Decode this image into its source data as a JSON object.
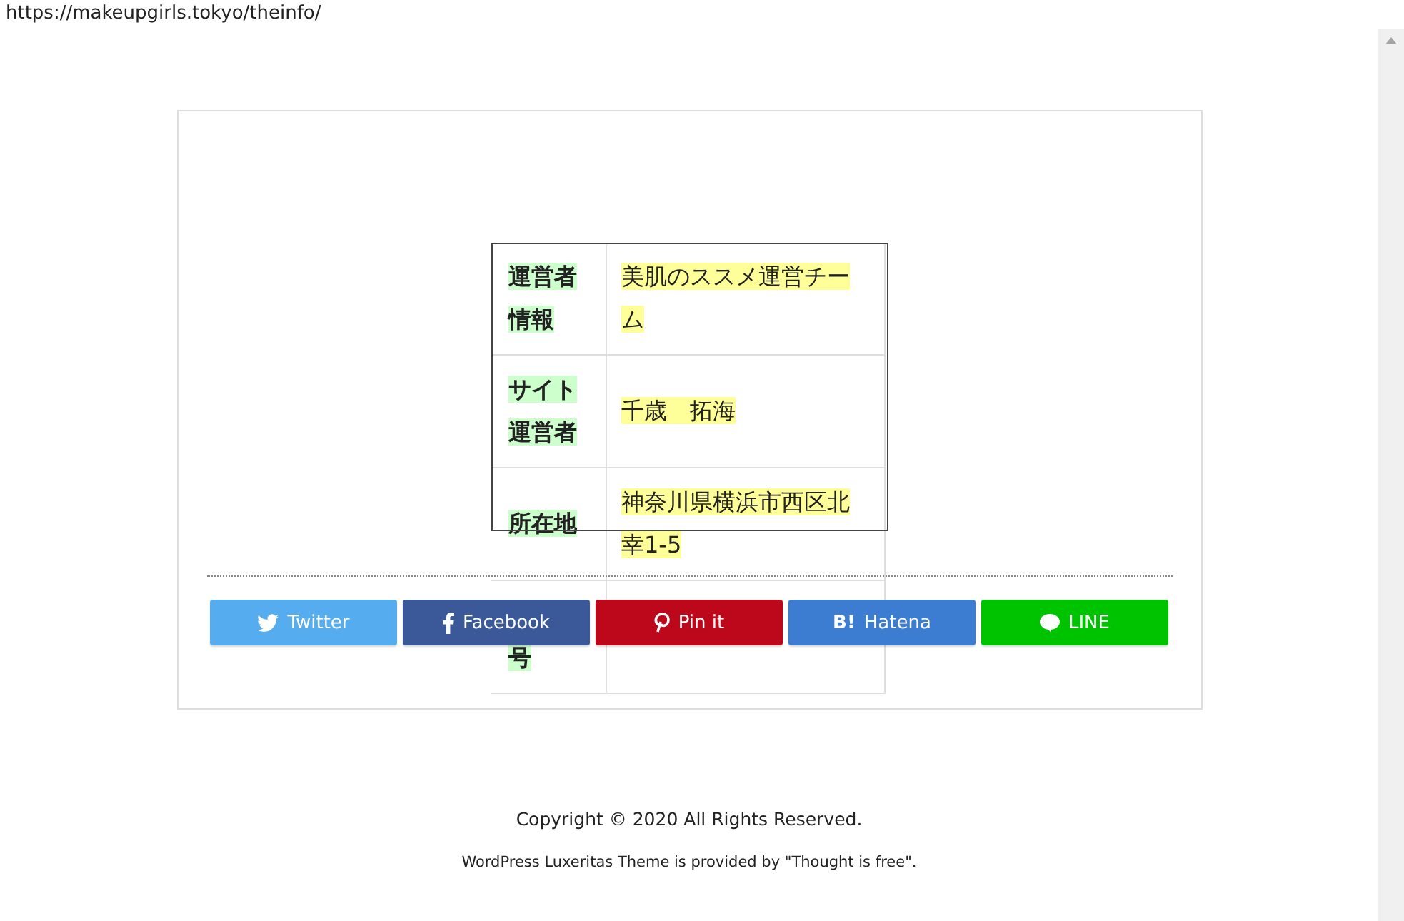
{
  "address_bar": {
    "url": "https://makeupgirls.tokyo/theinfo/"
  },
  "info_table": {
    "rows": [
      {
        "label": "運営者情報",
        "value": "美肌のススメ運営チーム"
      },
      {
        "label": "サイト運営者",
        "value": "千歳　拓海"
      },
      {
        "label": "所在地",
        "value": "神奈川県横浜市西区北幸1-5"
      },
      {
        "kind": "covered",
        "label": "号"
      }
    ]
  },
  "share_buttons": [
    {
      "kind": "twitter",
      "label": "Twitter",
      "color": "#55acee"
    },
    {
      "kind": "facebook",
      "label": "Facebook",
      "color": "#3b5998"
    },
    {
      "kind": "pinterest",
      "label": "Pin it",
      "color": "#bd081c"
    },
    {
      "kind": "hatena",
      "icon_text": "B!",
      "label": "Hatena",
      "color": "#3c7dd1"
    },
    {
      "kind": "line",
      "label": "LINE",
      "color": "#00c300"
    }
  ],
  "footer": {
    "copyright": "Copyright © 2020  All Rights Reserved.",
    "credit": "WordPress Luxeritas Theme is provided by \"Thought is free\"."
  }
}
